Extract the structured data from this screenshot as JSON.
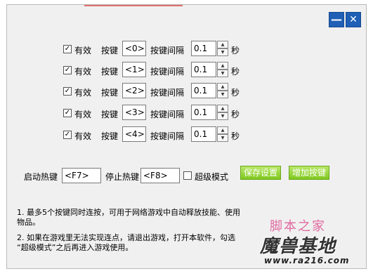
{
  "window": {
    "minimize_icon": "minimize-icon",
    "close_icon": "close-icon",
    "accent": "#1f5fb5"
  },
  "rows": [
    {
      "enabled_label": "有效",
      "key_label": "按键",
      "key_value": "<0>",
      "interval_label": "按键间隔",
      "interval_value": "0.1",
      "unit": "秒"
    },
    {
      "enabled_label": "有效",
      "key_label": "按键",
      "key_value": "<1>",
      "interval_label": "按键间隔",
      "interval_value": "0.1",
      "unit": "秒"
    },
    {
      "enabled_label": "有效",
      "key_label": "按键",
      "key_value": "<2>",
      "interval_label": "按键间隔",
      "interval_value": "0.1",
      "unit": "秒"
    },
    {
      "enabled_label": "有效",
      "key_label": "按键",
      "key_value": "<3>",
      "interval_label": "按键间隔",
      "interval_value": "0.1",
      "unit": "秒"
    },
    {
      "enabled_label": "有效",
      "key_label": "按键",
      "key_value": "<4>",
      "interval_label": "按键间隔",
      "interval_value": "0.1",
      "unit": "秒"
    }
  ],
  "hotkeys": {
    "start_label": "启动热键",
    "start_value": "<F7>",
    "stop_label": "停止热键",
    "stop_value": "<F8>",
    "super_mode_label": "超级模式",
    "save_label": "保存设置",
    "add_label": "增加按键",
    "button_color": "#7fc81e"
  },
  "notes": {
    "line1": "1.  最多5个按键同时连按，可用于网络游戏中自动释放技能、使用",
    "line1b": "物品。",
    "line2": "2.  如果在游戏里无法实现连点，请退出游戏，打开本软件，勾选",
    "line2b": "“超级模式”之后再进入游戏使用。"
  },
  "watermark": {
    "line1": "脚本之家",
    "line2": "魔兽基地",
    "line3": "www.ra216.com"
  }
}
